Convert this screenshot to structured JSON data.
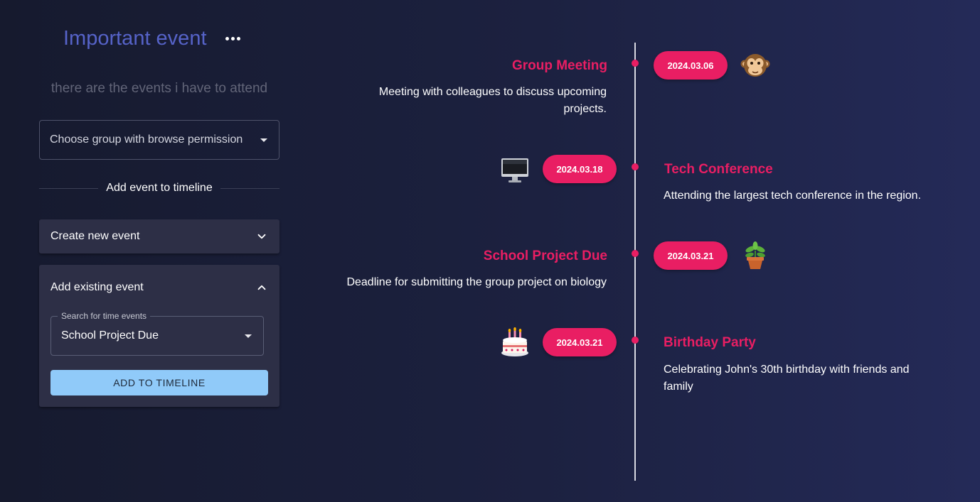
{
  "header": {
    "title": "Important event",
    "subtitle": "there are the events i have to attend"
  },
  "group_select": {
    "label": "Choose group with browse permission"
  },
  "divider_label": "Add event to timeline",
  "create_panel": {
    "label": "Create new event"
  },
  "existing_panel": {
    "label": "Add existing event",
    "search_legend": "Search for time events",
    "search_value": "School Project Due",
    "button_label": "ADD TO TIMELINE"
  },
  "timeline": {
    "events": [
      {
        "title": "Group Meeting",
        "date": "2024.03.06",
        "description": "Meeting with colleagues to discuss upcoming projects.",
        "icon": "monkey-icon"
      },
      {
        "title": "Tech Conference",
        "date": "2024.03.18",
        "description": "Attending the largest tech conference in the region.",
        "icon": "computer-icon"
      },
      {
        "title": "School Project Due",
        "date": "2024.03.21",
        "description": "Deadline for submitting the group project on biology",
        "icon": "potted-plant-icon"
      },
      {
        "title": "Birthday Party",
        "date": "2024.03.21",
        "description": "Celebrating John's 30th birthday with friends and family",
        "icon": "birthday-cake-icon"
      }
    ]
  },
  "colors": {
    "accent": "#e91e63",
    "title": "#5663c8",
    "button": "#90caf9",
    "panel": "#2d2f46"
  }
}
